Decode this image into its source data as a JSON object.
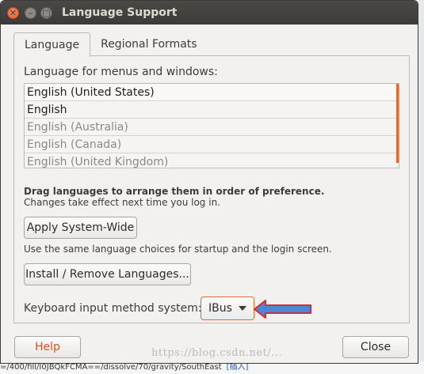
{
  "window": {
    "title": "Language Support"
  },
  "tabs": [
    {
      "label": "Language"
    },
    {
      "label": "Regional Formats"
    }
  ],
  "language_tab": {
    "heading": "Language for menus and windows:",
    "languages": [
      {
        "label": "English (United States)"
      },
      {
        "label": "English"
      },
      {
        "label": "English (Australia)"
      },
      {
        "label": "English (Canada)"
      },
      {
        "label": "English (United Kingdom)"
      }
    ],
    "drag_note_bold": "Drag languages to arrange them in order of preference.",
    "drag_note": "Changes take effect next time you log in.",
    "apply_button": "Apply System-Wide",
    "apply_desc": "Use the same language choices for startup and the login screen.",
    "install_button": "Install / Remove Languages...",
    "keyboard_label": "Keyboard input method system:",
    "keyboard_value": "IBus"
  },
  "footer": {
    "help_button": "Help",
    "close_button": "Close"
  },
  "watermark": "https://blog.csdn.net/...",
  "background_page": {
    "bottom_text": "=/400/fill/I0JBQkFCMA==/dissolve/70/gravity/SouthEast",
    "bottom_link": "[插入]"
  },
  "colors": {
    "accent": "#e4682d",
    "titlebar": "#3c3b37",
    "arrow_fill": "#4c86d6",
    "arrow_stroke": "#d32f2f"
  }
}
